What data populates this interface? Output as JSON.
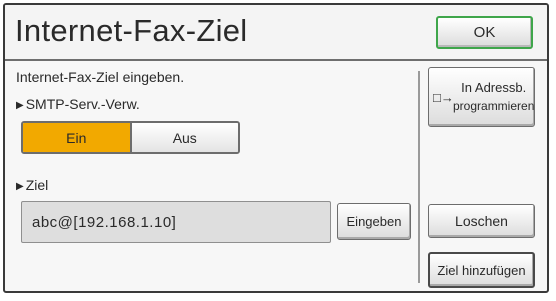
{
  "header": {
    "title": "Internet-Fax-Ziel",
    "ok_label": "OK"
  },
  "form": {
    "instruction": "Internet-Fax-Ziel eingeben.",
    "smtp_label": "SMTP-Serv.-Verw.",
    "smtp_options": [
      "Ein",
      "Aus"
    ],
    "smtp_selected": "Ein",
    "ziel_label": "Ziel",
    "address_value": "abc@[192.168.1.10]",
    "eingeben_label": "Eingeben"
  },
  "side": {
    "adressbuch_line1": "In Adressb.",
    "adressbuch_line2": "programmieren",
    "loeschen_label": "Loschen",
    "ziel_hinzufuegen_label": "Ziel hinzufügen"
  },
  "icons": {
    "arrow": "right-triangle-icon",
    "register": "address-book-register-icon"
  },
  "colors": {
    "selected": "#f2a900",
    "ok_border": "#3fa64b"
  }
}
